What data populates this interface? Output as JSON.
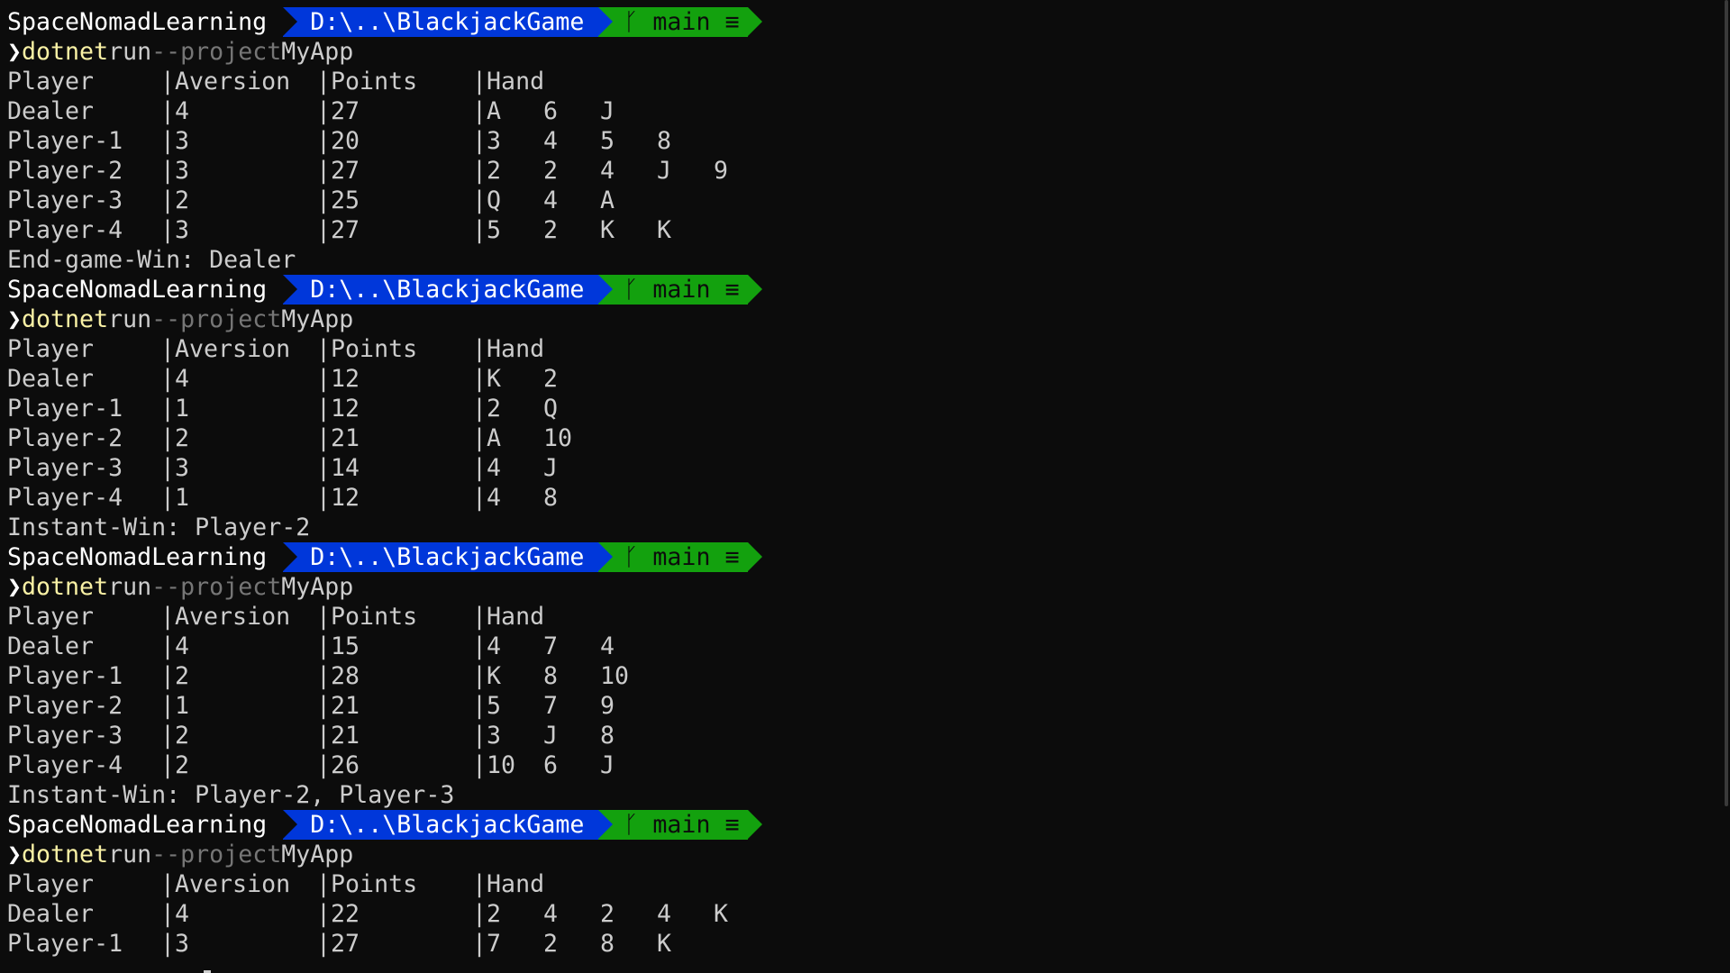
{
  "prompt": {
    "user": "SpaceNomadLearning",
    "path": "D:\\..\\BlackjackGame",
    "branch_icon": "ᚴ",
    "branch": "main",
    "status_icon": "≡"
  },
  "command": {
    "arrow": "❯",
    "name": "dotnet",
    "arg": "run",
    "flag": "--project",
    "value": "MyApp"
  },
  "header": {
    "player": "Player",
    "aversion": "Aversion",
    "points": "Points",
    "hand": "Hand",
    "sep": "|"
  },
  "runs": [
    {
      "rows": [
        {
          "player": "Dealer",
          "aversion": "4",
          "points": "27",
          "hand": [
            "A",
            "6",
            "J"
          ]
        },
        {
          "player": "Player-1",
          "aversion": "3",
          "points": "20",
          "hand": [
            "3",
            "4",
            "5",
            "8"
          ]
        },
        {
          "player": "Player-2",
          "aversion": "3",
          "points": "27",
          "hand": [
            "2",
            "2",
            "4",
            "J",
            "9"
          ]
        },
        {
          "player": "Player-3",
          "aversion": "2",
          "points": "25",
          "hand": [
            "Q",
            "4",
            "A"
          ]
        },
        {
          "player": "Player-4",
          "aversion": "3",
          "points": "27",
          "hand": [
            "5",
            "2",
            "K",
            "K"
          ]
        }
      ],
      "result": "End-game-Win: Dealer"
    },
    {
      "rows": [
        {
          "player": "Dealer",
          "aversion": "4",
          "points": "12",
          "hand": [
            "K",
            "2"
          ]
        },
        {
          "player": "Player-1",
          "aversion": "1",
          "points": "12",
          "hand": [
            "2",
            "Q"
          ]
        },
        {
          "player": "Player-2",
          "aversion": "2",
          "points": "21",
          "hand": [
            "A",
            "10"
          ]
        },
        {
          "player": "Player-3",
          "aversion": "3",
          "points": "14",
          "hand": [
            "4",
            "J"
          ]
        },
        {
          "player": "Player-4",
          "aversion": "1",
          "points": "12",
          "hand": [
            "4",
            "8"
          ]
        }
      ],
      "result": "Instant-Win: Player-2"
    },
    {
      "rows": [
        {
          "player": "Dealer",
          "aversion": "4",
          "points": "15",
          "hand": [
            "4",
            "7",
            "4"
          ]
        },
        {
          "player": "Player-1",
          "aversion": "2",
          "points": "28",
          "hand": [
            "K",
            "8",
            "10"
          ]
        },
        {
          "player": "Player-2",
          "aversion": "1",
          "points": "21",
          "hand": [
            "5",
            "7",
            "9"
          ]
        },
        {
          "player": "Player-3",
          "aversion": "2",
          "points": "21",
          "hand": [
            "3",
            "J",
            "8"
          ]
        },
        {
          "player": "Player-4",
          "aversion": "2",
          "points": "26",
          "hand": [
            "10",
            "6",
            "J"
          ]
        }
      ],
      "result": "Instant-Win: Player-2, Player-3"
    },
    {
      "rows": [
        {
          "player": "Dealer",
          "aversion": "4",
          "points": "22",
          "hand": [
            "2",
            "4",
            "2",
            "4",
            "K"
          ]
        },
        {
          "player": "Player-1",
          "aversion": "3",
          "points": "27",
          "hand": [
            "7",
            "2",
            "8",
            "K"
          ]
        }
      ],
      "result": ""
    }
  ],
  "colors": {
    "background": "#0c0c0c",
    "path_segment": "#0037da",
    "git_segment": "#13a10e",
    "command": "#f9f1a5",
    "flag": "#767676",
    "text": "#cccccc"
  }
}
